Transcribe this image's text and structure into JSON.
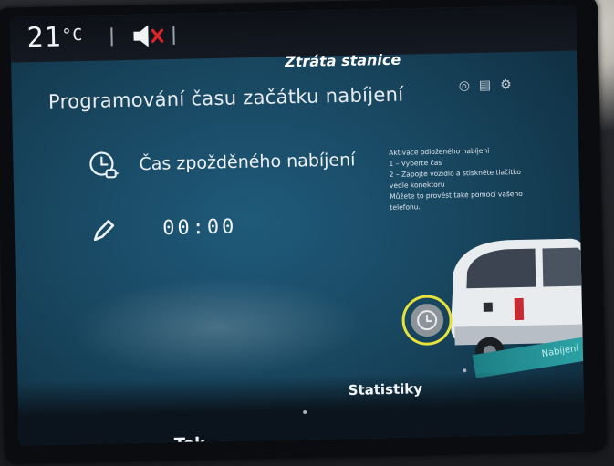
{
  "status_bar": {
    "temperature": "21",
    "temperature_unit": "°C",
    "mute_icon": "speaker-muted-icon",
    "title": "Ztráta stanice",
    "icons": [
      "map-pin-icon",
      "calendar-icon",
      "settings-icon"
    ]
  },
  "main": {
    "heading": "Programování času začátku nabíjení",
    "delay_label": "Čas zpožděného nabíjení",
    "time_value": "00:00"
  },
  "info": {
    "lines": [
      "Aktivace odloženého nabíjení",
      "1 – Vyberte čas",
      "2 – Zapojte vozidlo a stiskněte tlačítko",
      "vedle konektoru",
      "Můžete to provést také pomocí vašeho",
      "telefonu."
    ]
  },
  "illustration": {
    "teal_label": "Nabíjení"
  },
  "tabs": {
    "tok": "Tok",
    "statistiky": "Statistiky"
  },
  "colors": {
    "accent_teal": "#2ca5a8",
    "highlight_yellow": "#e7e23a",
    "mute_red": "#e0242c",
    "screen_blue": "#1f5a7a"
  }
}
